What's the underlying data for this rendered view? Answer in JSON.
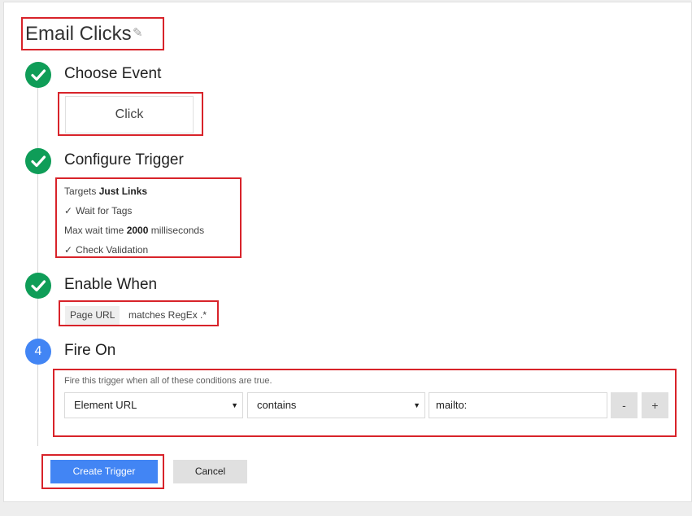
{
  "trigger": {
    "name": "Email Clicks",
    "edit_icon": "pencil-icon"
  },
  "steps": [
    {
      "title": "Choose Event",
      "status": "complete"
    },
    {
      "title": "Configure Trigger",
      "status": "complete"
    },
    {
      "title": "Enable When",
      "status": "complete"
    },
    {
      "number": "4",
      "title": "Fire On",
      "status": "active"
    }
  ],
  "event": {
    "value": "Click"
  },
  "configure": {
    "targets_label": "Targets",
    "targets_value": "Just Links",
    "wait_for_tags": "Wait for Tags",
    "max_wait_label": "Max wait time",
    "max_wait_value": "2000",
    "max_wait_unit": "milliseconds",
    "check_validation": "Check Validation"
  },
  "enable_when": {
    "variable": "Page URL",
    "condition": "matches RegEx .*"
  },
  "fire_on": {
    "description": "Fire this trigger when all of these conditions are true.",
    "variable": "Element URL",
    "operator": "contains",
    "value": "mailto:",
    "remove_label": "-",
    "add_label": "+"
  },
  "actions": {
    "create_label": "Create Trigger",
    "cancel_label": "Cancel"
  },
  "colors": {
    "complete": "#0f9d58",
    "active": "#4285f4",
    "primary_button": "#4285f4",
    "highlight_box": "#d8232a"
  }
}
